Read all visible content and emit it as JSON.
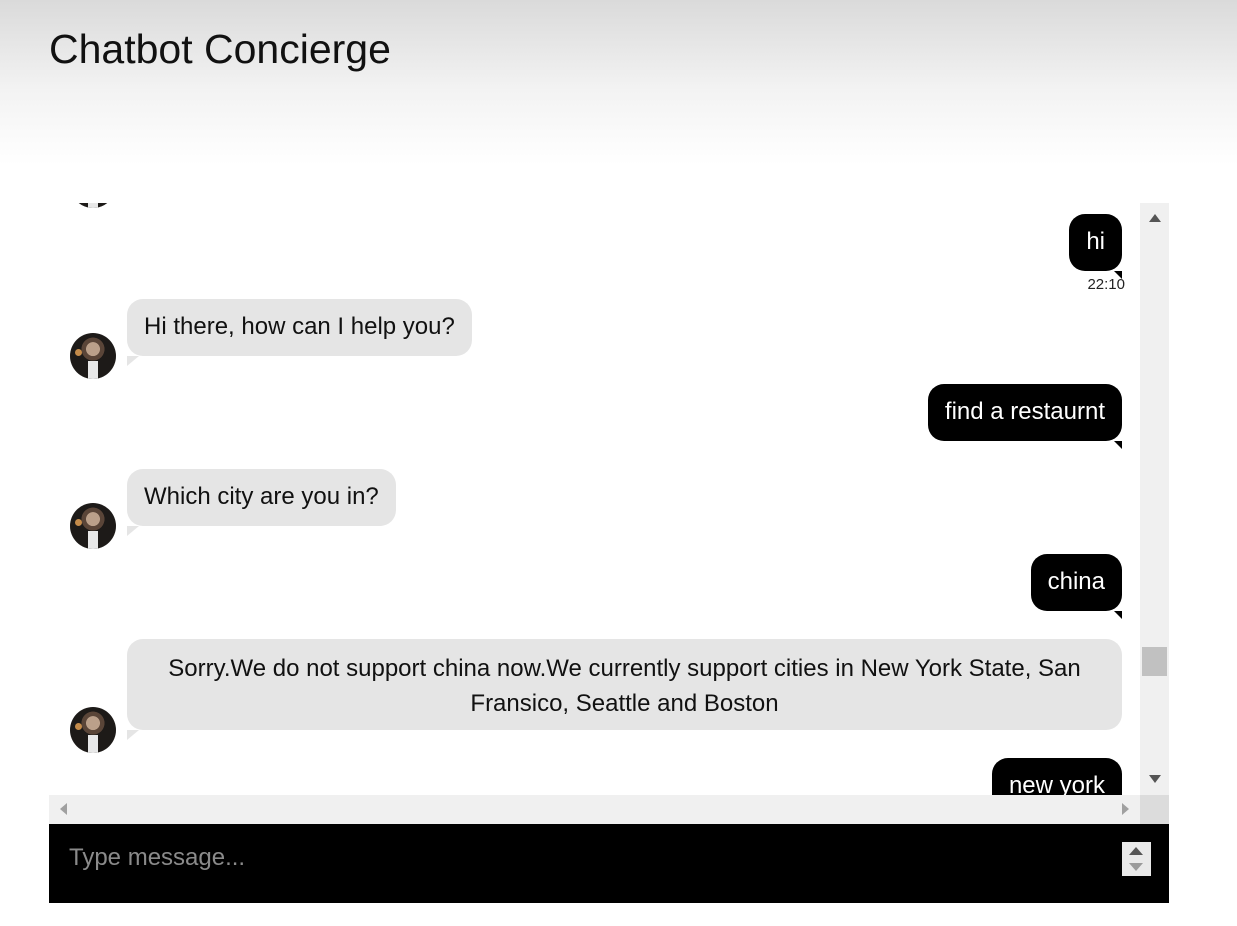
{
  "app": {
    "title": "Chatbot Concierge"
  },
  "messages": [
    {
      "sender": "user",
      "text": "hi",
      "time": "22:10"
    },
    {
      "sender": "bot",
      "text": "Hi there, how can I help you?"
    },
    {
      "sender": "user",
      "text": "find a restaurnt"
    },
    {
      "sender": "bot",
      "text": "Which city are you in?"
    },
    {
      "sender": "user",
      "text": "china"
    },
    {
      "sender": "bot",
      "text": "Sorry.We do not support china now.We currently support cities in New York State, San Fransico, Seattle and Boston"
    },
    {
      "sender": "user",
      "text": "new york"
    }
  ],
  "composer": {
    "placeholder": "Type message...",
    "value": ""
  },
  "colors": {
    "user_bubble": "#000000",
    "bot_bubble": "#e5e5e5",
    "composer_bg": "#000000"
  }
}
